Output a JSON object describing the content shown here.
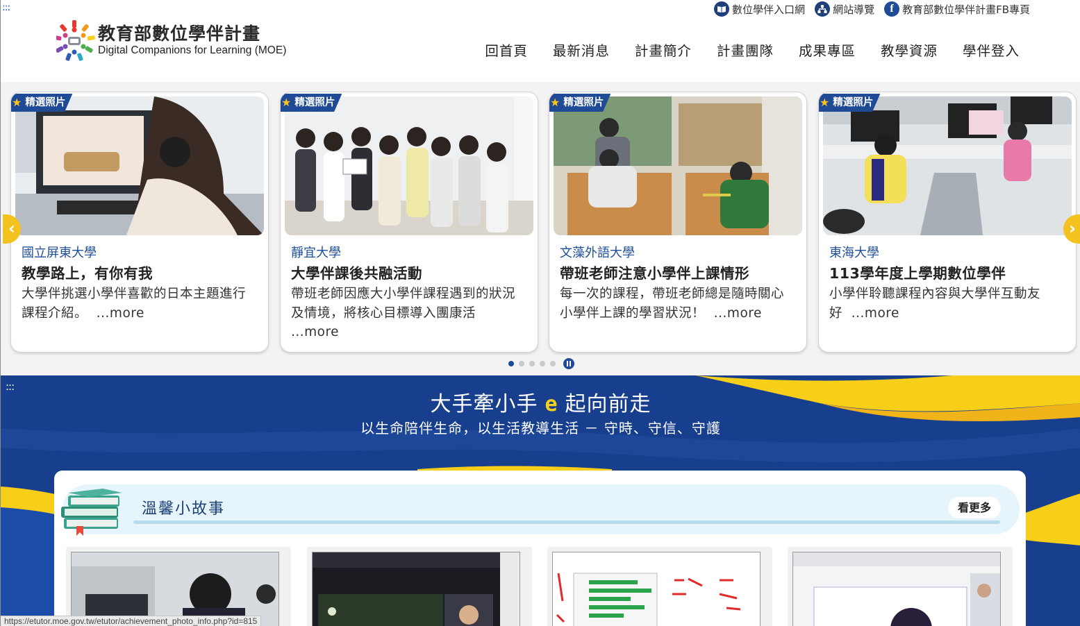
{
  "header": {
    "accesskey": ":::",
    "logo_zh": "教育部數位學伴計畫",
    "logo_en": "Digital Companions for Learning (MOE)",
    "top_links": [
      {
        "label": "數位學伴入口網",
        "icon": "book-icon"
      },
      {
        "label": "網站導覽",
        "icon": "sitemap-icon"
      },
      {
        "label": "教育部數位學伴計畫FB專頁",
        "icon": "facebook-icon"
      }
    ],
    "nav": [
      "回首頁",
      "最新消息",
      "計畫簡介",
      "計畫團隊",
      "成果專區",
      "教學資源",
      "學伴登入"
    ]
  },
  "carousel": {
    "badge": "精選照片",
    "more": "...more",
    "cards": [
      {
        "university": "國立屏東大學",
        "title": "教學路上，有你有我",
        "desc": "大學伴挑選小學伴喜歡的日本主題進行課程介紹。"
      },
      {
        "university": "靜宜大學",
        "title": "大學伴課後共融活動",
        "desc": "帶班老師因應大小學伴課程遇到的狀況及情境，將核心目標導入團康活"
      },
      {
        "university": "文藻外語大學",
        "title": "帶班老師注意小學伴上課情形",
        "desc": "每一次的課程，帶班老師總是隨時關心小學伴上課的學習狀況！"
      },
      {
        "university": "東海大學",
        "title": "113學年度上學期數位學伴",
        "desc": "小學伴聆聽課程內容與大學伴互動友好"
      }
    ],
    "dots_total": 5,
    "dots_active": 1,
    "colors": {
      "accent": "#1e4a96",
      "arrow": "#f4c21f"
    }
  },
  "banner": {
    "accesskey": ":::",
    "slogan_before": "大手牽小手",
    "slogan_e": "e",
    "slogan_after": "起向前走",
    "motto": "以生命陪伴生命，以生活教導生活 － 守時、守信、守護",
    "colors": {
      "blue": "#183f8e",
      "yellow": "#f7cf19"
    }
  },
  "stories": {
    "title": "溫馨小故事",
    "more_button": "看更多"
  },
  "status_bar": {
    "url": "https://etutor.moe.gov.tw/etutor/achievement_photo_info.php?id=815"
  }
}
